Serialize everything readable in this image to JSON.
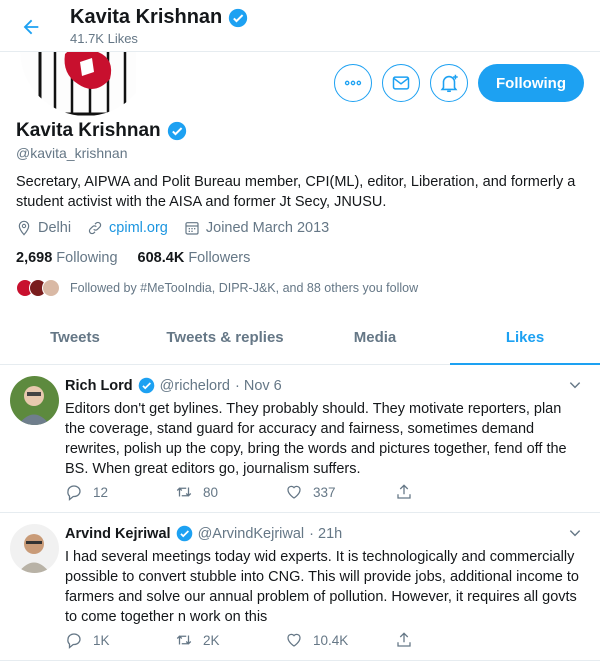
{
  "topbar": {
    "title": "Kavita Krishnan",
    "likes": "41.7K Likes"
  },
  "profile": {
    "name": "Kavita Krishnan",
    "handle": "@kavita_krishnan",
    "bio": "Secretary, AIPWA and Polit Bureau member, CPI(ML), editor, Liberation, and formerly a student activist with the AISA and former Jt Secy, JNUSU.",
    "location": "Delhi",
    "website": "cpiml.org",
    "joined": "Joined March 2013",
    "following_count": "2,698",
    "following_label": "Following",
    "followers_count": "608.4K",
    "followers_label": "Followers",
    "followed_by": "Followed by #MeTooIndia, DIPR-J&K, and 88 others you follow",
    "follow_button": "Following"
  },
  "tabs": [
    {
      "label": "Tweets"
    },
    {
      "label": "Tweets & replies"
    },
    {
      "label": "Media"
    },
    {
      "label": "Likes"
    }
  ],
  "tweets": [
    {
      "name": "Rich Lord",
      "handle": "@richelord",
      "time": "· Nov 6",
      "text": "Editors don't get bylines. They probably should. They motivate reporters, plan the coverage, stand guard for accuracy and fairness, sometimes demand rewrites, polish up the copy, bring the words and pictures together, fend off the BS. When great editors go, journalism suffers.",
      "replies": "12",
      "retweets": "80",
      "likes": "337"
    },
    {
      "name": "Arvind Kejriwal",
      "handle": "@ArvindKejriwal",
      "time": "· 21h",
      "text": "I had several meetings today wid experts. It is technologically and commercially possible to convert stubble into CNG. This will provide jobs, additional income to farmers and solve our annual problem of pollution. However, it requires all govts to come together n work on this",
      "replies": "1K",
      "retweets": "2K",
      "likes": "10.4K"
    }
  ],
  "colors": {
    "accent": "#1da1f2",
    "muted": "#657786",
    "text": "#14171a",
    "border": "#e6ecf0"
  },
  "icons": [
    "back-arrow-icon",
    "verified-icon",
    "more-icon",
    "mail-icon",
    "notify-icon",
    "location-icon",
    "link-icon",
    "calendar-icon",
    "reply-icon",
    "retweet-icon",
    "like-icon",
    "share-icon",
    "chevron-down-icon"
  ]
}
